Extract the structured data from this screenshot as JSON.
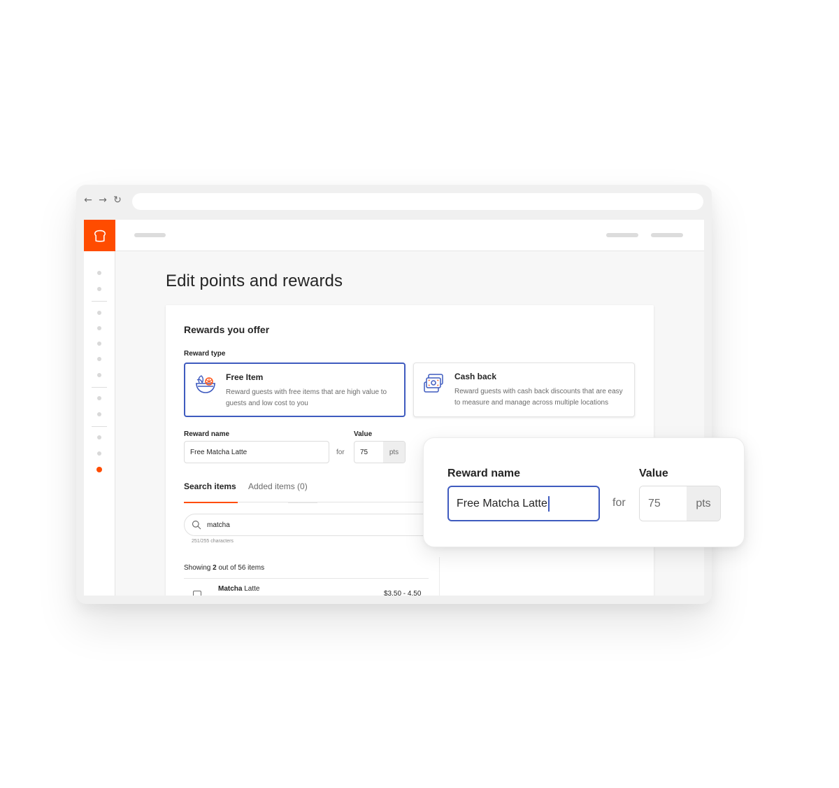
{
  "browser": {
    "nav": {
      "back_icon": "←",
      "forward_icon": "→",
      "reload_icon": "↻"
    },
    "address_bar_value": ""
  },
  "app": {
    "brand_color": "#ff4c00",
    "accent_color": "#3f5bbf",
    "logo_icon": "toast-bread-icon",
    "sidebar": {
      "active_index": 11,
      "item_count": 12
    }
  },
  "page": {
    "title": "Edit points and rewards"
  },
  "rewards_card": {
    "title": "Rewards you offer",
    "reward_type_label": "Reward type",
    "options": [
      {
        "title": "Free Item",
        "description": "Reward guests with free items that are high value to guests and low cost to you",
        "icon": "salad-bowl-icon",
        "selected": true
      },
      {
        "title": "Cash back",
        "description": "Reward guests with cash back discounts that are easy to measure and manage across multiple locations",
        "icon": "cash-bills-icon",
        "selected": false
      }
    ],
    "reward_name_label": "Reward name",
    "reward_name_value": "Free Matcha Latte",
    "for_label": "for",
    "value_label": "Value",
    "value_number": "75",
    "value_unit": "pts",
    "tabs": [
      {
        "label": "Search items",
        "active": true
      },
      {
        "label": "Added items (0)",
        "active": false
      }
    ],
    "search": {
      "value": "matcha",
      "char_count": "251/255 characters"
    },
    "showing": {
      "prefix": "Showing ",
      "count": "2",
      "suffix": " out of 56 items"
    },
    "items": [
      {
        "name_bold": "Matcha",
        "name_rest": " Latte",
        "price": "$3.50 - 4.50",
        "checked": false
      }
    ]
  },
  "popup": {
    "reward_name_label": "Reward name",
    "reward_name_value": "Free Matcha Latte",
    "for_label": "for",
    "value_label": "Value",
    "value_number": "75",
    "value_unit": "pts"
  }
}
